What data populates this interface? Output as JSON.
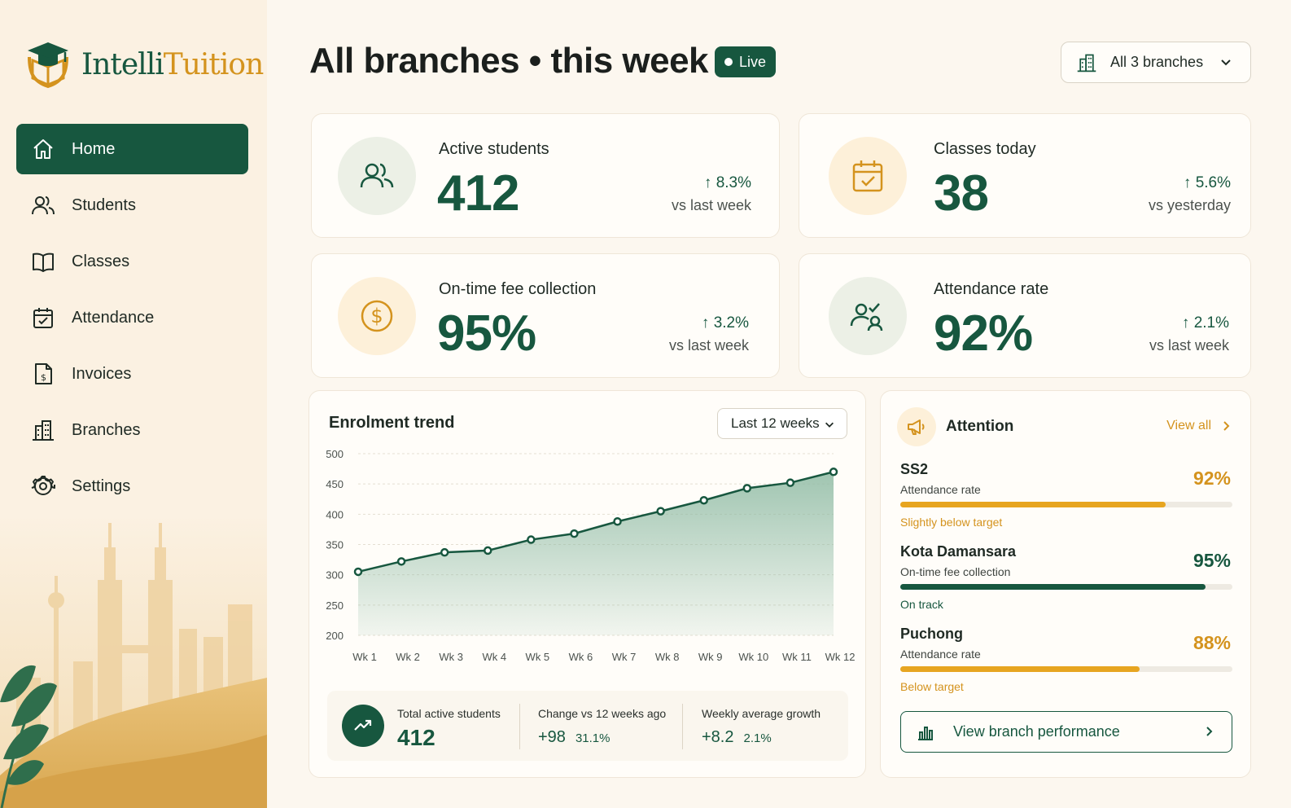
{
  "brand": {
    "name_part1": "Intelli",
    "name_part2": "Tuition"
  },
  "nav": {
    "items": [
      {
        "label": "Home",
        "icon": "home-icon",
        "active": true
      },
      {
        "label": "Students",
        "icon": "users-icon"
      },
      {
        "label": "Classes",
        "icon": "book-icon"
      },
      {
        "label": "Attendance",
        "icon": "calendar-check-icon"
      },
      {
        "label": "Invoices",
        "icon": "invoice-icon"
      },
      {
        "label": "Branches",
        "icon": "building-icon"
      },
      {
        "label": "Settings",
        "icon": "gear-icon"
      }
    ]
  },
  "header": {
    "title": "All branches • this week",
    "live_badge": "Live",
    "branch_select": "All 3 branches"
  },
  "stats": [
    {
      "label": "Active students",
      "value": "412",
      "delta": "8.3%",
      "delta_sub": "vs last week",
      "icon": "users-icon"
    },
    {
      "label": "Classes today",
      "value": "38",
      "delta": "5.6%",
      "delta_sub": "vs yesterday",
      "icon": "calendar-check-icon"
    },
    {
      "label": "On-time fee collection",
      "value": "95%",
      "delta": "3.2%",
      "delta_sub": "vs last week",
      "icon": "dollar-icon"
    },
    {
      "label": "Attendance rate",
      "value": "92%",
      "delta": "2.1%",
      "delta_sub": "vs last week",
      "icon": "user-check-icon"
    }
  ],
  "trend": {
    "title": "Enrolment trend",
    "range": "Last 12 weeks",
    "summary": {
      "total_label": "Total active students",
      "total_value": "412",
      "change_label": "Change vs 12 weeks ago",
      "change_value": "+98",
      "change_pct": "31.1%",
      "growth_label": "Weekly average growth",
      "growth_value": "+8.2",
      "growth_pct": "2.1%"
    }
  },
  "chart_data": {
    "type": "area",
    "title": "Enrolment trend",
    "categories": [
      "Wk 1",
      "Wk 2",
      "Wk 3",
      "Wk 4",
      "Wk 5",
      "Wk 6",
      "Wk 7",
      "Wk 8",
      "Wk 9",
      "Wk 10",
      "Wk 11",
      "Wk 12"
    ],
    "series": [
      {
        "values": [
          305,
          322,
          337,
          340,
          358,
          368,
          388,
          405,
          423,
          443,
          452,
          470
        ]
      }
    ],
    "yticks": [
      200,
      250,
      300,
      350,
      400,
      450,
      500
    ],
    "ylim": [
      200,
      500
    ],
    "grid": true,
    "line_color": "#17573f",
    "fill_color": "#8fbba4"
  },
  "attention": {
    "title": "Attention",
    "view_all": "View all",
    "items": [
      {
        "name": "SS2",
        "metric": "Attendance rate",
        "pct": "92%",
        "fill": 0.8,
        "status": "Slightly below target",
        "color": "#e7a521",
        "text_color": "#d4931e"
      },
      {
        "name": "Kota Damansara",
        "metric": "On-time fee collection",
        "pct": "95%",
        "fill": 0.92,
        "status": "On track",
        "color": "#17573f",
        "text_color": "#17573f"
      },
      {
        "name": "Puchong",
        "metric": "Attendance rate",
        "pct": "88%",
        "fill": 0.72,
        "status": "Below target",
        "color": "#e7a521",
        "text_color": "#d4931e"
      }
    ],
    "button": "View branch performance"
  }
}
